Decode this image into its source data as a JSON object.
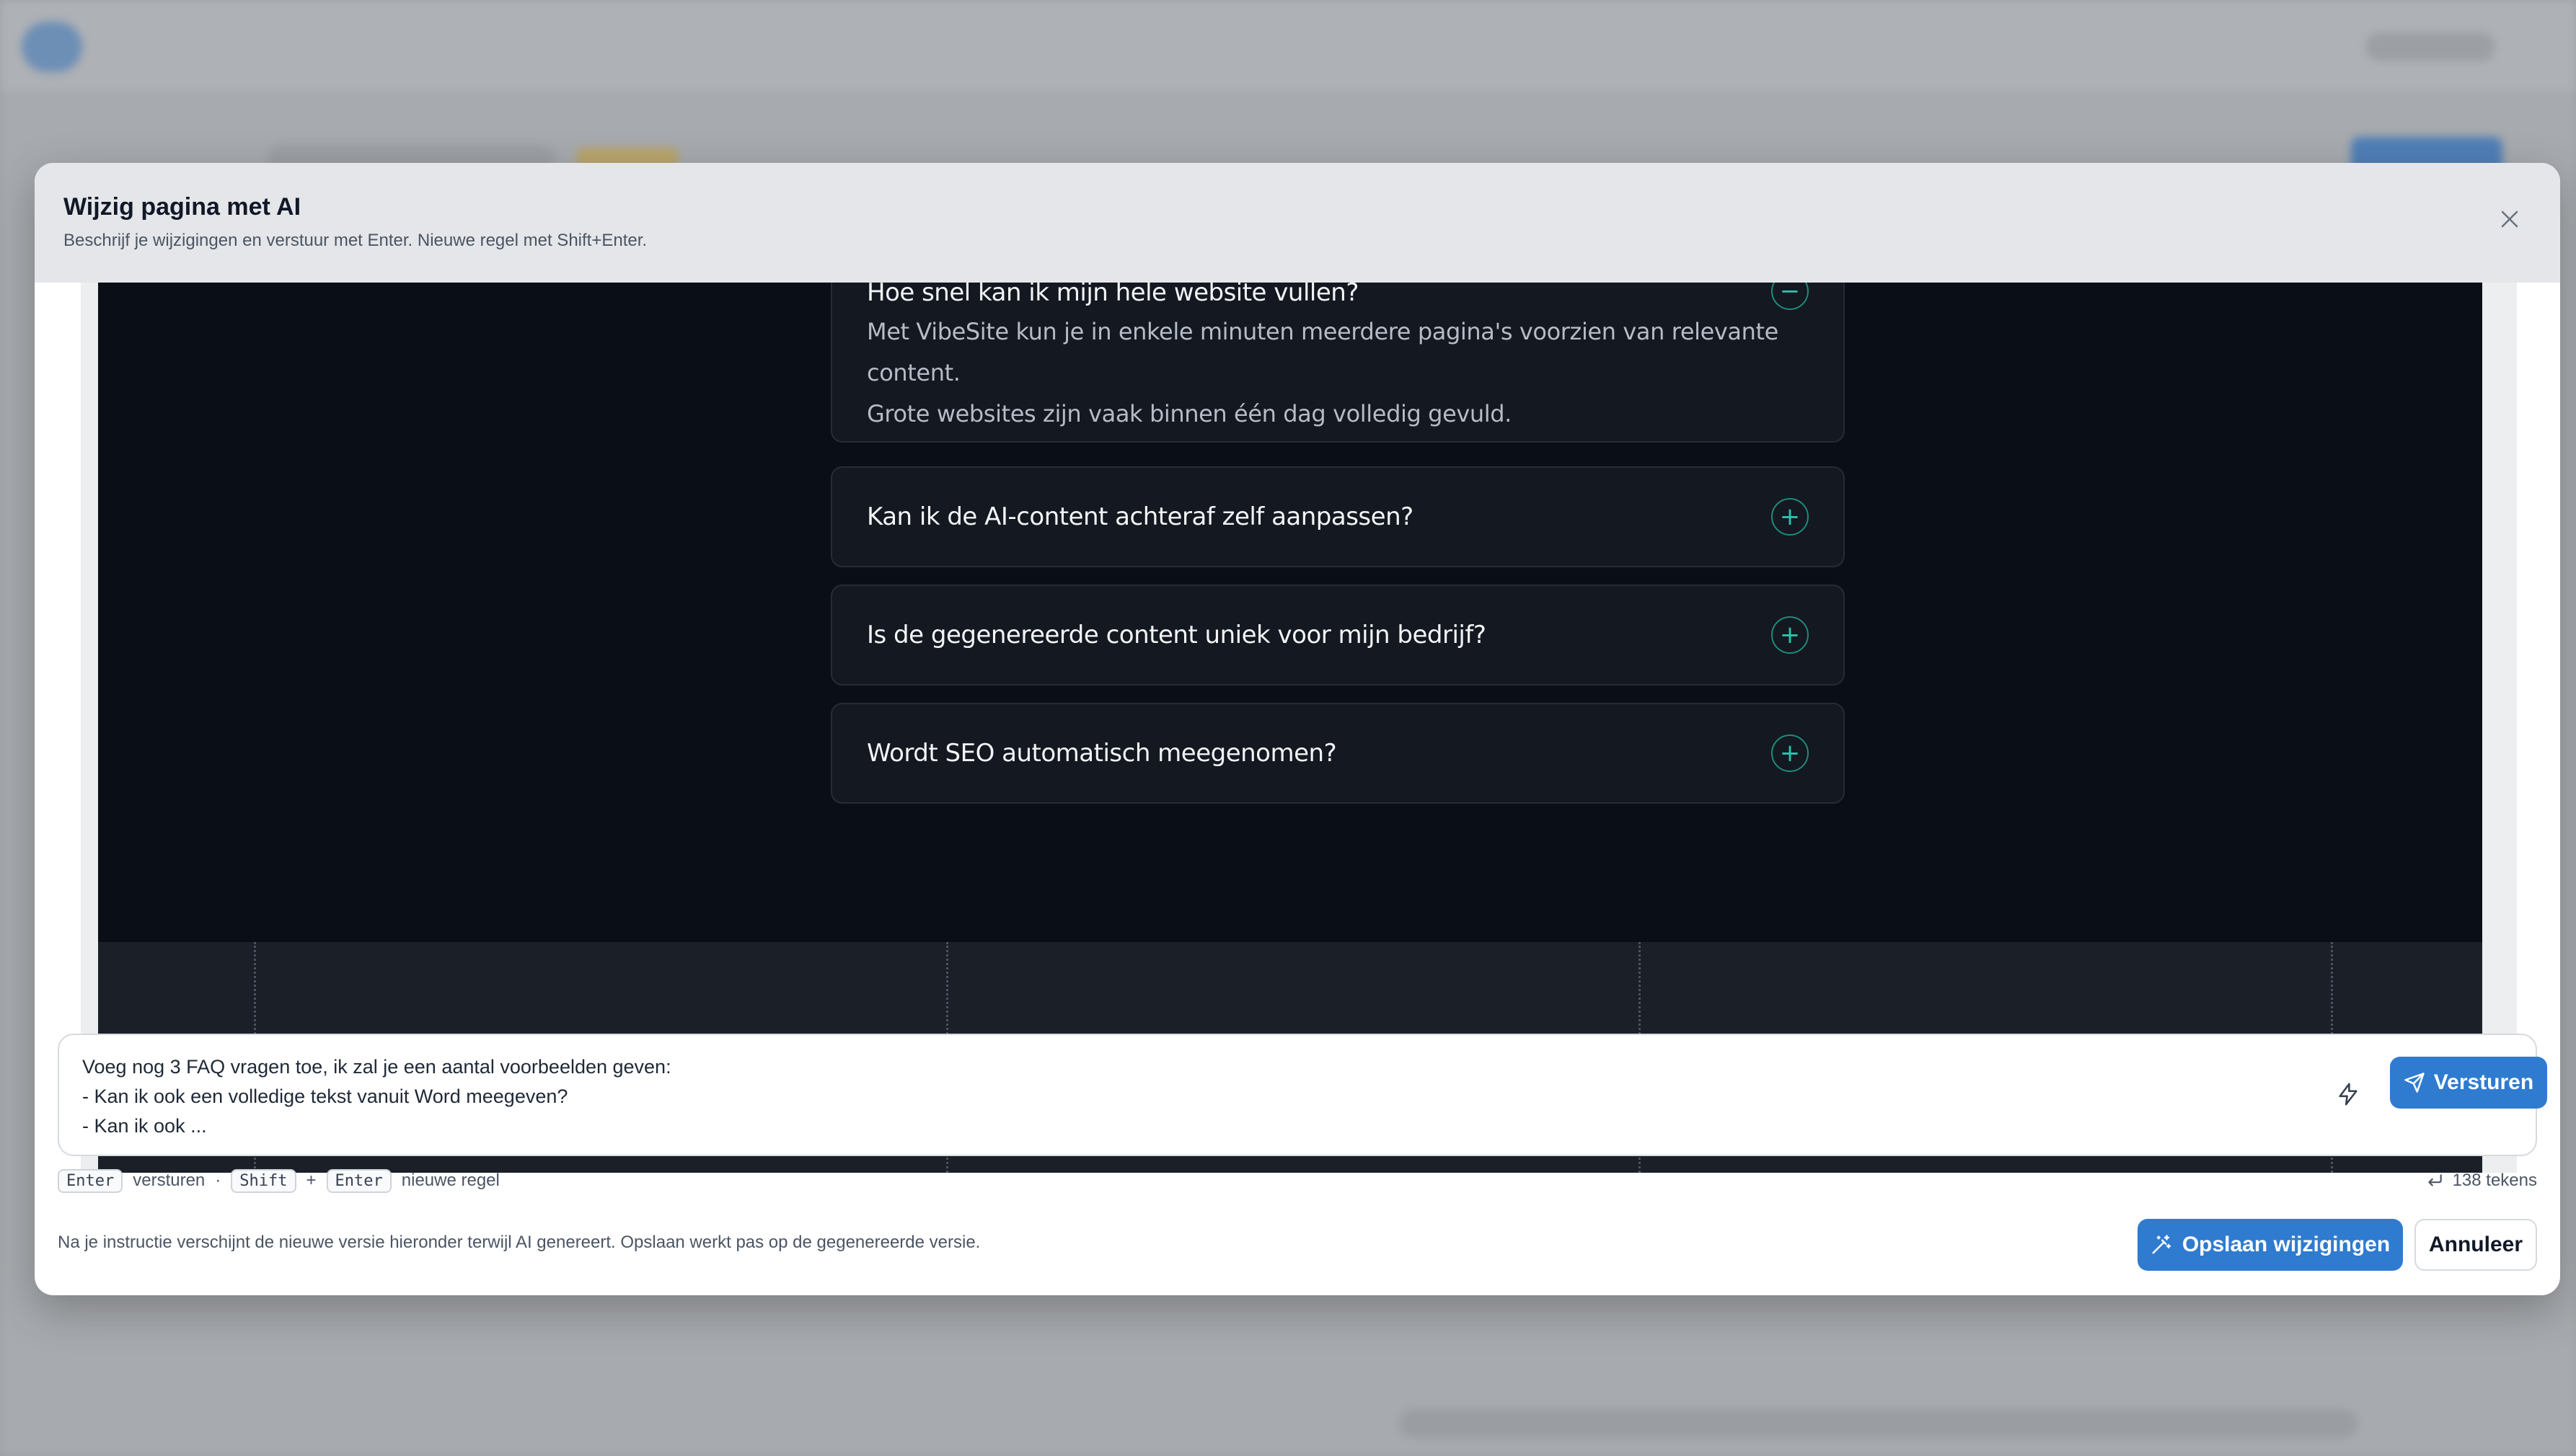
{
  "modal": {
    "title": "Wijzig pagina met AI",
    "subtitle": "Beschrijf je wijzigingen en verstuur met Enter. Nieuwe regel met Shift+Enter.",
    "close_icon": "close-icon"
  },
  "preview": {
    "faq": [
      {
        "question": "Hoe snel kan ik mijn hele website vullen?",
        "answer_line1": "Met VibeSite kun je in enkele minuten meerdere pagina's voorzien van relevante content.",
        "answer_line2": "Grote websites zijn vaak binnen één dag volledig gevuld.",
        "toggle": "−",
        "expanded": true
      },
      {
        "question": "Kan ik de AI-content achteraf zelf aanpassen?",
        "toggle": "+",
        "expanded": false
      },
      {
        "question": "Is de gegenereerde content uniek voor mijn bedrijf?",
        "toggle": "+",
        "expanded": false
      },
      {
        "question": "Wordt SEO automatisch meegenomen?",
        "toggle": "+",
        "expanded": false
      }
    ],
    "accent_color": "#2cc3ad"
  },
  "input": {
    "value": "Voeg nog 3 FAQ vragen toe, ik zal je een aantal voorbeelden geven:\n- Kan ik ook een volledige tekst vanuit Word meegeven?\n- Kan ik ook ...",
    "send_label": "Versturen",
    "bolt_icon": "lightning-icon",
    "send_icon": "send-icon"
  },
  "hints": {
    "enter_key": "Enter",
    "enter_label": "versturen",
    "separator": "·",
    "shift_key": "Shift",
    "plus": "+",
    "enter_key2": "Enter",
    "newline_label": "nieuwe regel",
    "char_count": "138 tekens",
    "return_icon": "return-icon"
  },
  "footer": {
    "note": "Na je instructie verschijnt de nieuwe versie hieronder terwijl AI genereert. Opslaan werkt pas op de gegenereerde versie.",
    "save_label": "Opslaan wijzigingen",
    "cancel_label": "Annuleer",
    "magic_icon": "magic-wand-icon"
  },
  "colors": {
    "primary": "#2f7bd0",
    "preview_bg": "#0a0e17"
  }
}
